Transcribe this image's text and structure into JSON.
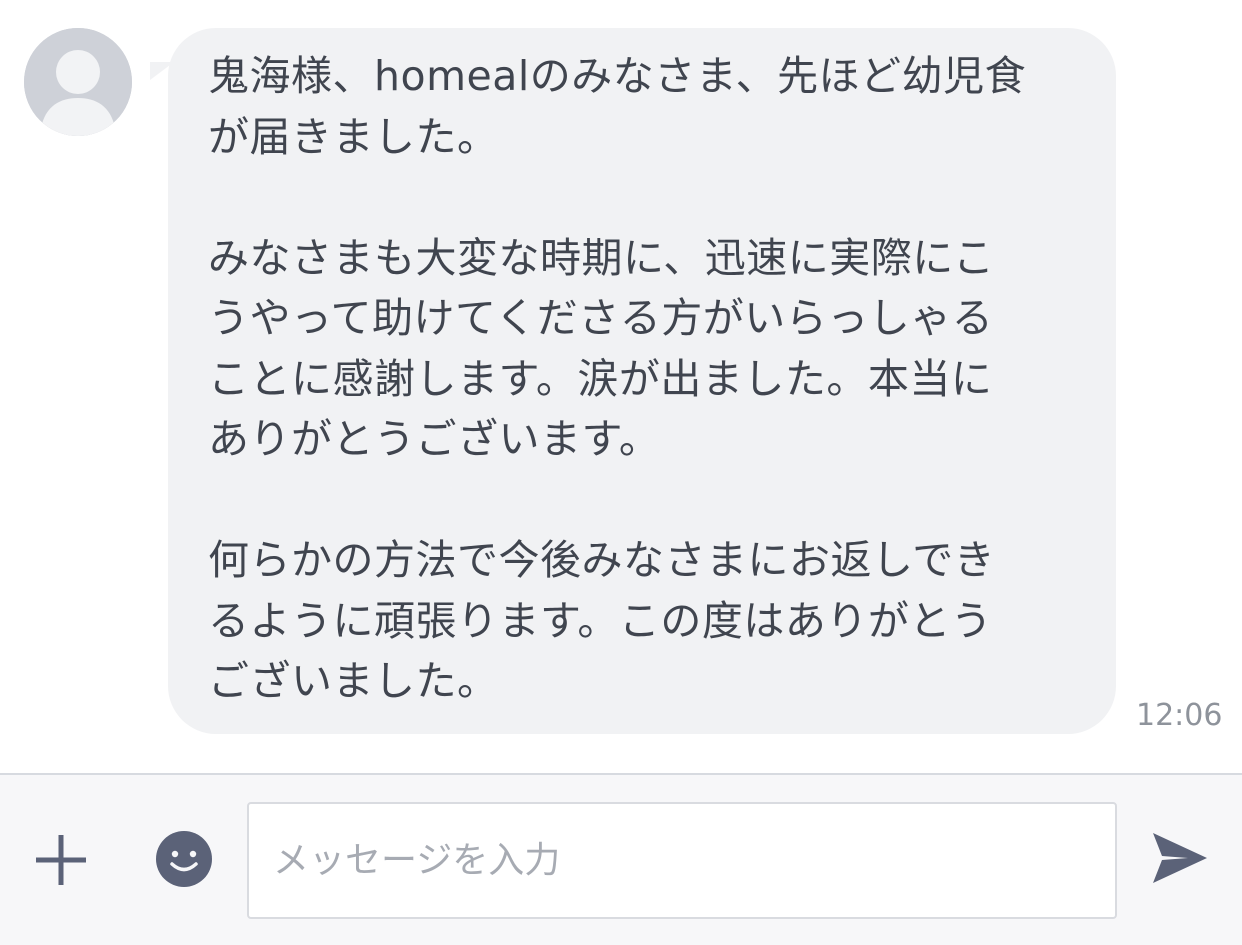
{
  "message": {
    "text": "鬼海様、homealのみなさま、先ほど幼児食\nが届きました。\n\nみなさまも大変な時期に、迅速に実際にこ\nうやって助けてくださる方がいらっしゃる\nことに感謝します。涙が出ました。本当に\nありがとうございます。\n\n何らかの方法で今後みなさまにお返しでき\nるように頑張ります。この度はありがとう\nございました。",
    "time": "12:06"
  },
  "composer": {
    "placeholder": "メッセージを入力"
  },
  "icons": {
    "add": "plus-icon",
    "emoji": "smiley-icon",
    "send": "send-icon",
    "avatar": "default-avatar-icon"
  },
  "colors": {
    "bubble": "#f1f2f4",
    "text": "#40454f",
    "icon": "#5b6278",
    "avatar_bg": "#ced1d8"
  }
}
